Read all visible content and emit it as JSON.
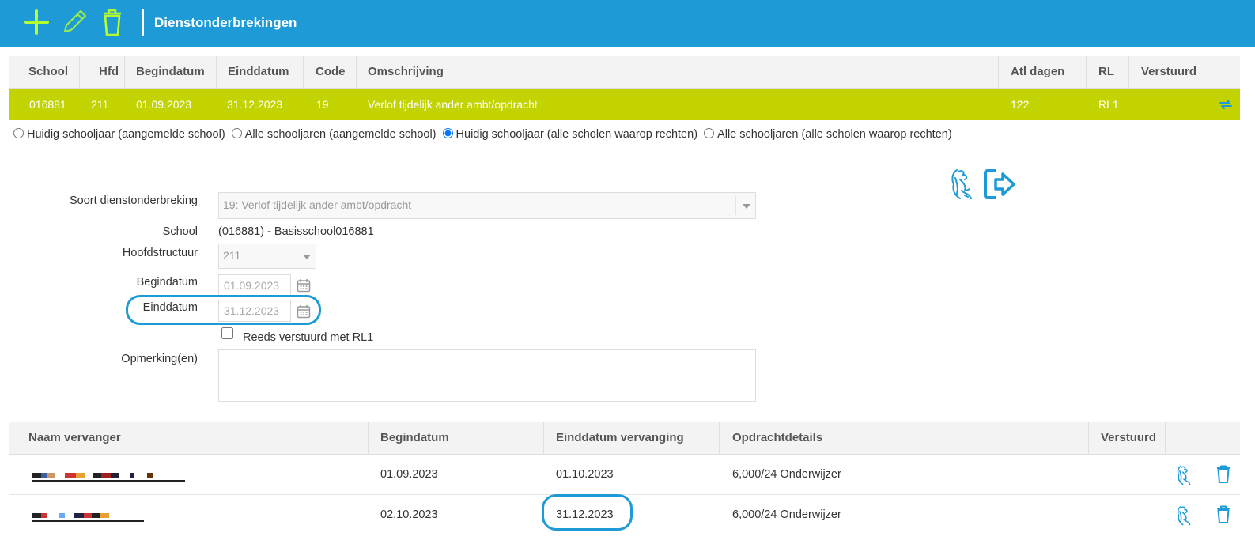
{
  "toolbar": {
    "title": "Dienstonderbrekingen",
    "add_icon": "plus-icon",
    "edit_icon": "pencil-icon",
    "delete_icon": "trash-icon",
    "color_bg": "#1e9ad6",
    "color_icon": "#b5ff2e"
  },
  "main_table": {
    "headers": [
      "School",
      "Hfd",
      "Begindatum",
      "Einddatum",
      "Code",
      "Omschrijving",
      "Atl dagen",
      "RL",
      "Verstuurd"
    ],
    "rows": [
      {
        "school": "016881",
        "hfd": "211",
        "begindatum": "01.09.2023",
        "einddatum": "31.12.2023",
        "code": "19",
        "omschrijving": "Verlof tijdelijk ander ambt/opdracht",
        "atl_dagen": "122",
        "rl": "RL1",
        "verstuurd": "",
        "action_icon": "swap-arrows-icon"
      }
    ],
    "selected_row_color": "#c3d300"
  },
  "filters": {
    "options": [
      {
        "label": "Huidig schooljaar (aangemelde school)",
        "checked": false
      },
      {
        "label": "Alle schooljaren (aangemelde school)",
        "checked": false
      },
      {
        "label": "Huidig schooljaar (alle scholen waarop rechten)",
        "checked": true
      },
      {
        "label": "Alle schooljaren (alle scholen waarop rechten)",
        "checked": false
      }
    ]
  },
  "actions": {
    "flemish_icon": "flemish-lion-icon",
    "export_icon": "sign-out-arrow-icon"
  },
  "form": {
    "soort_label": "Soort dienstonderbreking",
    "soort_value": "19: Verlof tijdelijk ander ambt/opdracht",
    "school_label": "School",
    "school_value": "(016881) - Basisschool016881",
    "hoofdstructuur_label": "Hoofdstructuur",
    "hoofdstructuur_value": "211",
    "begindatum_label": "Begindatum",
    "begindatum_value": "01.09.2023",
    "einddatum_label": "Einddatum",
    "einddatum_value": "31.12.2023",
    "reeds_label": "Reeds verstuurd met RL1",
    "reeds_checked": false,
    "opmerking_label": "Opmerking(en)",
    "opmerking_value": ""
  },
  "replacements": {
    "headers": [
      "Naam vervanger",
      "Begindatum",
      "Einddatum vervanging",
      "Opdrachtdetails",
      "Verstuurd"
    ],
    "rows": [
      {
        "naam": "",
        "begindatum": "01.09.2023",
        "einddatum": "01.10.2023",
        "opdracht": "6,000/24 Onderwijzer",
        "verstuurd": ""
      },
      {
        "naam": "",
        "begindatum": "02.10.2023",
        "einddatum": "31.12.2023",
        "opdracht": "6,000/24 Onderwijzer",
        "verstuurd": ""
      }
    ],
    "row_icons": [
      "flemish-lion-icon",
      "trash-icon"
    ]
  },
  "annotation_color": "#1e9ad6"
}
